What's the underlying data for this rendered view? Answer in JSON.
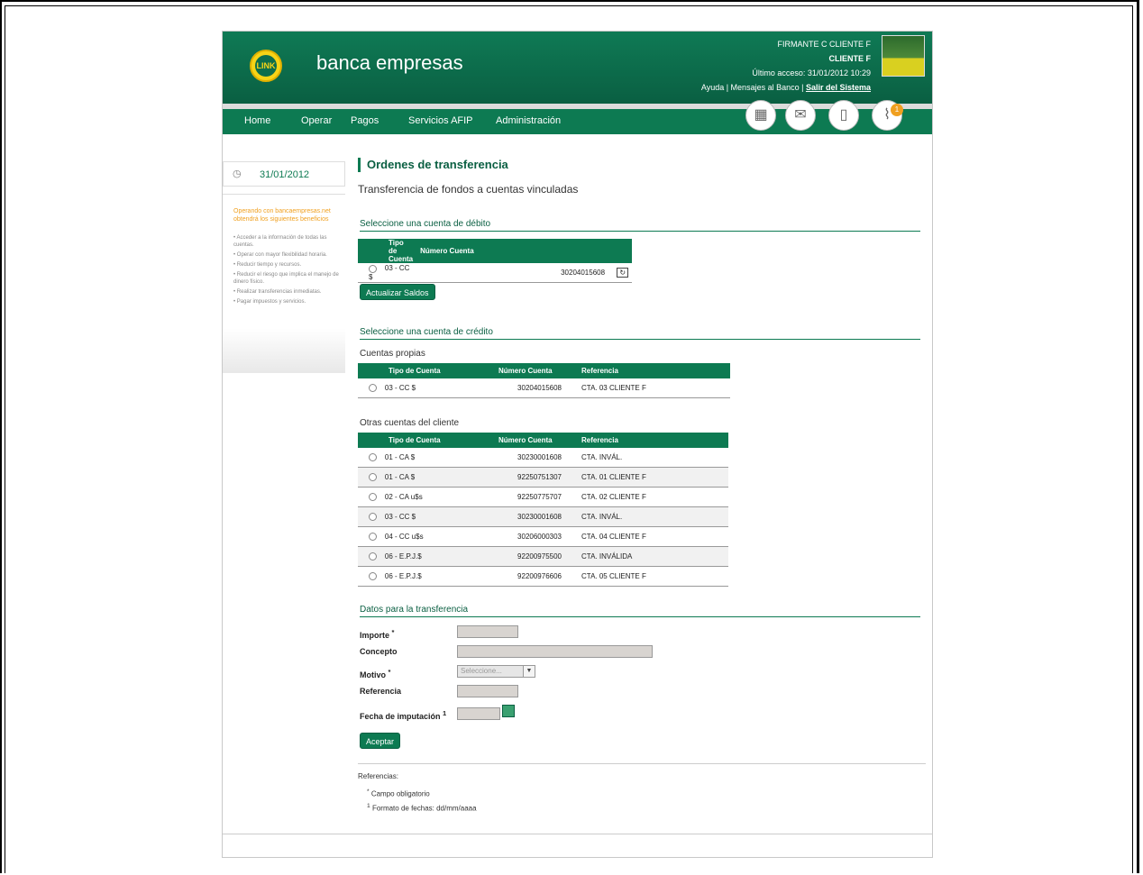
{
  "header": {
    "logo_text": "LINK",
    "brand": "banca empresas",
    "firmante": "FIRMANTE C CLIENTE F",
    "cliente": "CLIENTE F",
    "ultimo_acceso": "Último acceso: 31/01/2012 10:29",
    "links_prefix": "Ayuda | Mensajes al Banco |",
    "logout": "Salir del Sistema"
  },
  "nav": {
    "items": [
      "Home",
      "Operar",
      "Pagos",
      "Servicios AFIP",
      "Administración"
    ],
    "badge_count": "1"
  },
  "sidebar": {
    "date": "31/01/2012",
    "benefits_head": "Operando con bancaempresas.net obtendrá los siguientes beneficios",
    "benefits": [
      "Acceder a la información de todas las cuentas.",
      "Operar con mayor flexibilidad horaria.",
      "Reducir tiempo y recursos.",
      "Reducir el riesgo que implica el manejo de dinero físico.",
      "Realizar transferencias inmediatas.",
      "Pagar impuestos y servicios."
    ]
  },
  "main": {
    "title": "Ordenes de transferencia",
    "subtitle": "Transferencia de fondos a cuentas vinculadas",
    "debit_section": "Seleccione una cuenta de débito",
    "debit_headers": [
      "Tipo de Cuenta",
      "Número Cuenta"
    ],
    "debit_rows": [
      {
        "tipo": "03 - CC $",
        "numero": "30204015608"
      }
    ],
    "update_button": "Actualizar Saldos",
    "credit_section": "Seleccione una cuenta de crédito",
    "own_label": "Cuentas propias",
    "own_headers": [
      "Tipo de Cuenta",
      "Número Cuenta",
      "Referencia"
    ],
    "own_rows": [
      {
        "tipo": "03 - CC $",
        "numero": "30204015608",
        "ref": "CTA. 03 CLIENTE F"
      }
    ],
    "other_label": "Otras cuentas del cliente",
    "other_headers": [
      "Tipo de Cuenta",
      "Número Cuenta",
      "Referencia"
    ],
    "other_rows": [
      {
        "tipo": "01 - CA $",
        "numero": "30230001608",
        "ref": "CTA. INVÁL."
      },
      {
        "tipo": "01 - CA $",
        "numero": "92250751307",
        "ref": "CTA. 01 CLIENTE F"
      },
      {
        "tipo": "02 - CA u$s",
        "numero": "92250775707",
        "ref": "CTA. 02 CLIENTE F"
      },
      {
        "tipo": "03 - CC $",
        "numero": "30230001608",
        "ref": "CTA. INVÁL."
      },
      {
        "tipo": "04 - CC u$s",
        "numero": "30206000303",
        "ref": "CTA. 04 CLIENTE F"
      },
      {
        "tipo": "06 - E.P.J.$",
        "numero": "92200975500",
        "ref": "CTA. INVÁLIDA"
      },
      {
        "tipo": "06 - E.P.J.$",
        "numero": "92200976606",
        "ref": "CTA. 05 CLIENTE F"
      }
    ],
    "transfer_section": "Datos para la transferencia",
    "importe_label": "Importe",
    "concepto_label": "Concepto",
    "motivo_label": "Motivo",
    "motivo_placeholder": "Seleccione...",
    "referencia_label": "Referencia",
    "fecha_label": "Fecha de imputación",
    "required_mark": "*",
    "note_mark": "1",
    "accept_button": "Aceptar",
    "refs_title": "Referencias:",
    "ref_required": "Campo obligatorio",
    "ref_date": "Formato de fechas: dd/mm/aaaa"
  }
}
